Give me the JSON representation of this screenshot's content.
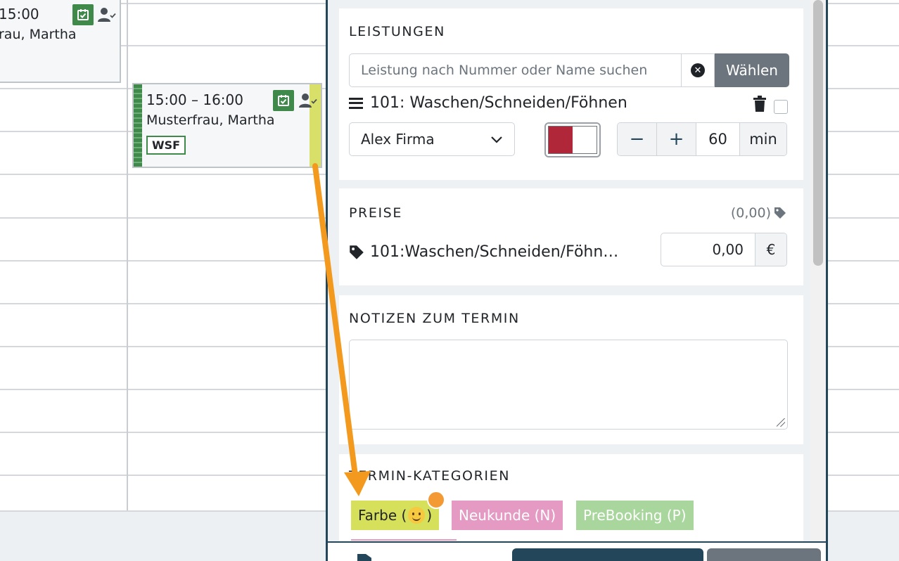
{
  "calendar": {
    "event_top": {
      "time": "15:00",
      "name": "rau, Martha"
    },
    "event_main": {
      "time": "15:00 – 16:00",
      "name": "Musterfrau, Martha",
      "tag": "WSF"
    }
  },
  "panel": {
    "leistungen": {
      "title": "LEISTUNGEN",
      "search_placeholder": "Leistung nach Nummer oder Name suchen",
      "choose_label": "Wählen",
      "service_label": "101: Waschen/Schneiden/Föhnen",
      "staff_value": "Alex Firma",
      "duration_value": "60",
      "duration_unit": "min",
      "minus_label": "−",
      "plus_label": "+"
    },
    "preise": {
      "title": "PREISE",
      "total_hint": "(0,00)",
      "item_label": "101:Waschen/Schneiden/Föhn…",
      "price_value": "0,00",
      "currency": "€"
    },
    "notizen": {
      "title": "NOTIZEN ZUM TERMIN",
      "value": ""
    },
    "kategorien": {
      "title": "TERMIN-KATEGORIEN",
      "chips": [
        {
          "label_before": "Farbe (",
          "label_after": ")"
        },
        {
          "label": "Neukunde (N)"
        },
        {
          "label": "PreBooking (P)"
        }
      ]
    }
  },
  "colors": {
    "accent_dark": "#24465a",
    "event_green": "#3f8a4b",
    "chip_farbe": "#d6e05b",
    "chip_neukunde": "#e49ac3",
    "chip_prebooking": "#a8d69d",
    "staff_color": "#b1273a",
    "annotation_arrow": "#f39a1e"
  },
  "icons": [
    "check-calendar-icon",
    "person-check-icon",
    "clear-icon",
    "chevron-down-icon",
    "hamburger-icon",
    "trash-icon",
    "price-tag-icon",
    "smile-emoji-icon",
    "resize-grip-icon",
    "document-icon"
  ]
}
